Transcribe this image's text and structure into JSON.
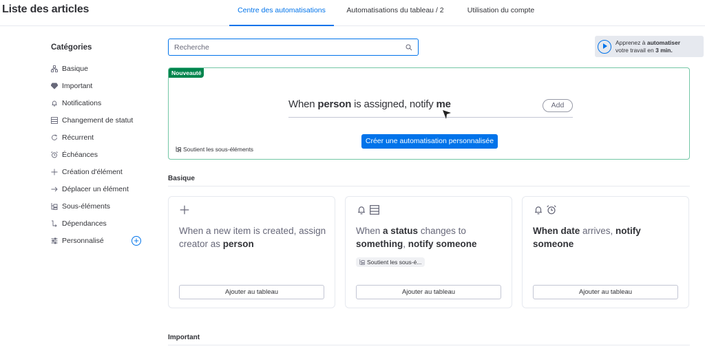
{
  "header": {
    "title": "Liste des articles",
    "tabs": [
      {
        "label": "Centre des automatisations",
        "active": true
      },
      {
        "label": "Automatisations du tableau  / 2"
      },
      {
        "label": "Utilisation du compte"
      }
    ]
  },
  "sidebar": {
    "title": "Catégories",
    "items": [
      {
        "label": "Basique",
        "icon": "hierarchy-icon"
      },
      {
        "label": "Important",
        "icon": "diamond-icon"
      },
      {
        "label": "Notifications",
        "icon": "bell-icon"
      },
      {
        "label": "Changement de statut",
        "icon": "status-icon"
      },
      {
        "label": "Récurrent",
        "icon": "recurring-icon"
      },
      {
        "label": "Échéances",
        "icon": "alarm-icon"
      },
      {
        "label": "Création d'élément",
        "icon": "plus-icon"
      },
      {
        "label": "Déplacer un élément",
        "icon": "arrow-right-icon"
      },
      {
        "label": "Sous-éléments",
        "icon": "subitems-icon"
      },
      {
        "label": "Dépendances",
        "icon": "dependency-icon"
      },
      {
        "label": "Personnalisé",
        "icon": "sliders-icon"
      }
    ]
  },
  "search": {
    "placeholder": "Recherche",
    "value": ""
  },
  "promo": {
    "line1": "Apprenez à ",
    "line1_bold": "automatiser",
    "line2": "votre travail en ",
    "line2_bold": "3 min."
  },
  "featured": {
    "badge": "Nouveauté",
    "sentence": [
      {
        "t": "When "
      },
      {
        "t": "person",
        "b": true
      },
      {
        "t": " is assigned, notify "
      },
      {
        "t": "me",
        "b": true
      }
    ],
    "add": "Add",
    "create_button": "Créer une automatisation personnalisée",
    "subitems": "Soutient les sous-éléments"
  },
  "sections": {
    "basique": "Basique",
    "important": "Important"
  },
  "cards": [
    {
      "sentence": [
        {
          "t": "When a new item is created, assign creator as "
        },
        {
          "t": "person",
          "b": true
        }
      ],
      "button": "Ajouter au tableau"
    },
    {
      "sentence": [
        {
          "t": "When "
        },
        {
          "t": "a status",
          "b": true
        },
        {
          "t": " changes to "
        },
        {
          "t": "something",
          "b": true
        },
        {
          "t": ", "
        },
        {
          "t": "notify someone",
          "b": true
        }
      ],
      "chip": "Soutient les sous-é...",
      "button": "Ajouter au tableau"
    },
    {
      "sentence": [
        {
          "t": "When date",
          "b": true
        },
        {
          "t": " arrives, "
        },
        {
          "t": "notify someone",
          "b": true
        }
      ],
      "button": "Ajouter au tableau"
    }
  ],
  "colors": {
    "accent": "#0073ea",
    "new_badge": "#00854d"
  }
}
